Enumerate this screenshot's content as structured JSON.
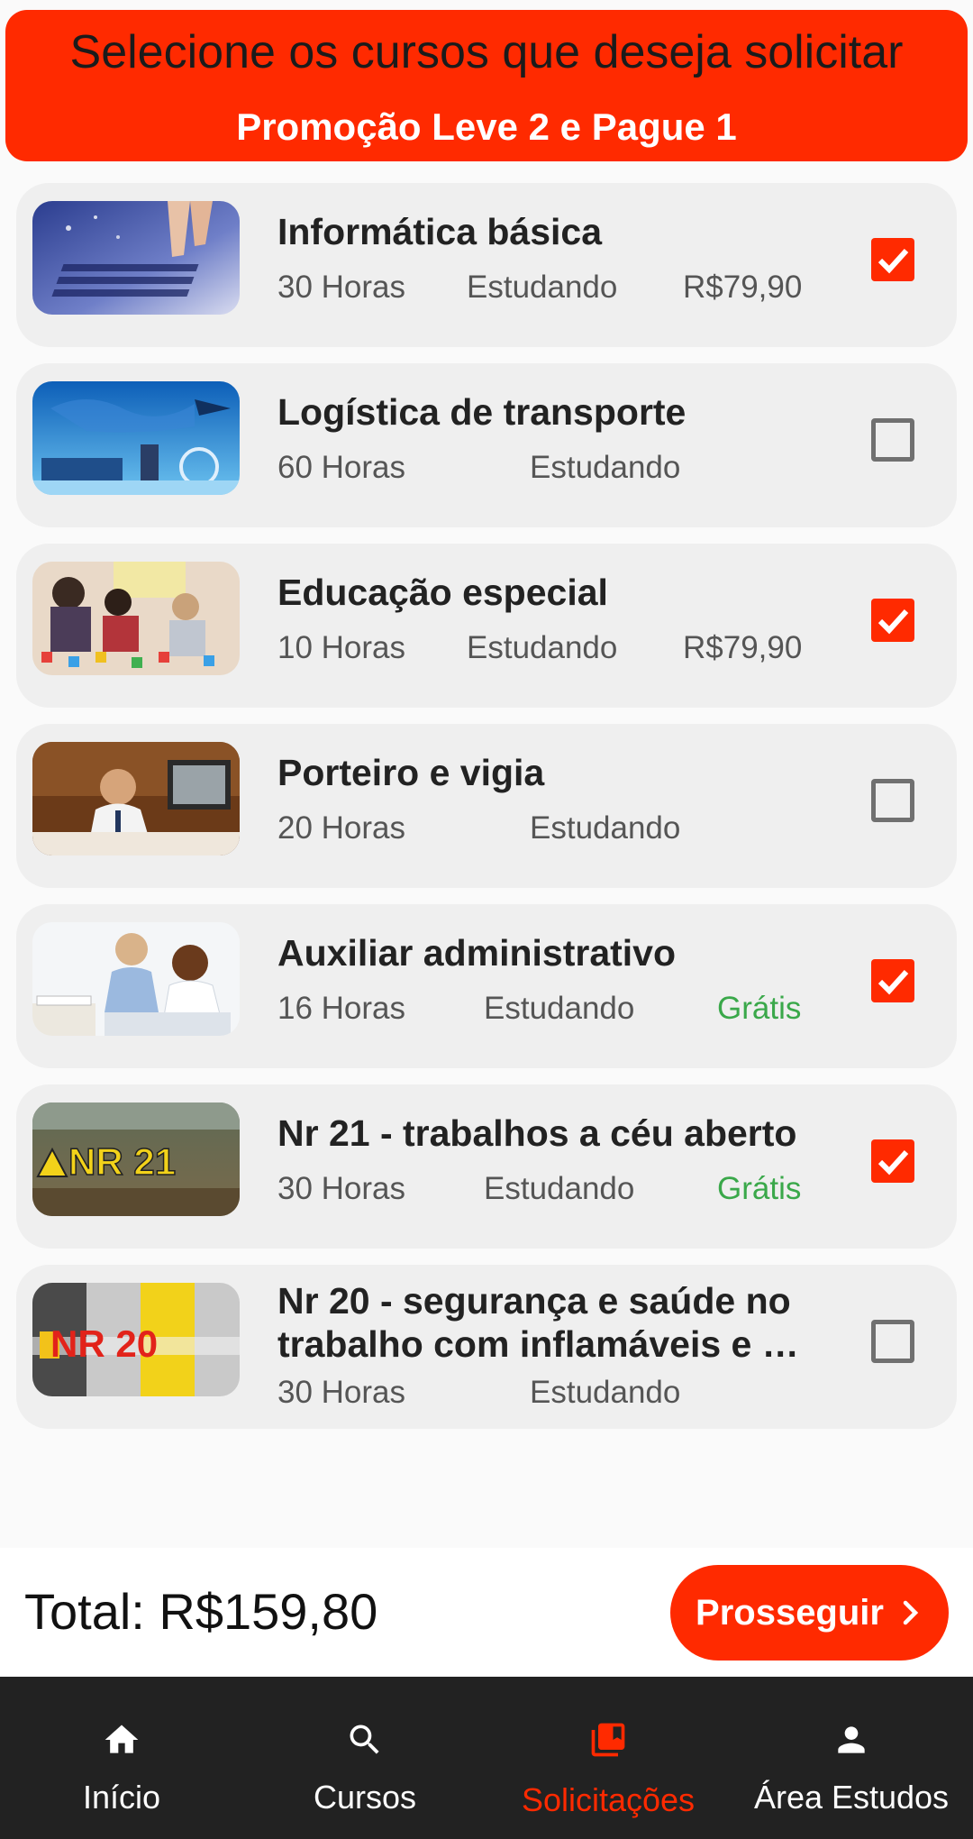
{
  "header": {
    "title": "Selecione os cursos que deseja solicitar",
    "promo": "Promoção Leve 2 e Pague 1"
  },
  "courses": [
    {
      "title": "Informática básica",
      "hours": "30 Horas",
      "status": "Estudando",
      "price": "R$79,90",
      "selected": true
    },
    {
      "title": "Logística de transporte",
      "hours": "60 Horas",
      "status": "Estudando",
      "price": "",
      "selected": false
    },
    {
      "title": "Educação especial",
      "hours": "10 Horas",
      "status": "Estudando",
      "price": "R$79,90",
      "selected": true
    },
    {
      "title": "Porteiro e vigia",
      "hours": "20 Horas",
      "status": "Estudando",
      "price": "",
      "selected": false
    },
    {
      "title": "Auxiliar administrativo",
      "hours": "16 Horas",
      "status": "Estudando",
      "price": "Grátis",
      "selected": true
    },
    {
      "title": "Nr 21 - trabalhos a céu aberto",
      "hours": "30 Horas",
      "status": "Estudando",
      "price": "Grátis",
      "selected": true
    },
    {
      "title": "Nr 20 - segurança e saúde no trabalho com inflamáveis e …",
      "hours": "30 Horas",
      "status": "Estudando",
      "price": "",
      "selected": false
    }
  ],
  "thumb_text": {
    "nr21": "NR 21",
    "nr20": "NR 20"
  },
  "footer": {
    "total": "Total: R$159,80",
    "proceed_label": "Prosseguir"
  },
  "nav": {
    "items": [
      {
        "label": "Início",
        "icon": "home-icon",
        "active": false
      },
      {
        "label": "Cursos",
        "icon": "search-icon",
        "active": false
      },
      {
        "label": "Solicitações",
        "icon": "library-bookmark-icon",
        "active": true
      },
      {
        "label": "Área Estudos",
        "icon": "person-icon",
        "active": false
      }
    ]
  },
  "colors": {
    "accent": "#ff2a00",
    "free": "#3aa84a",
    "nav_bg": "#222222",
    "card_bg": "#efefef"
  }
}
